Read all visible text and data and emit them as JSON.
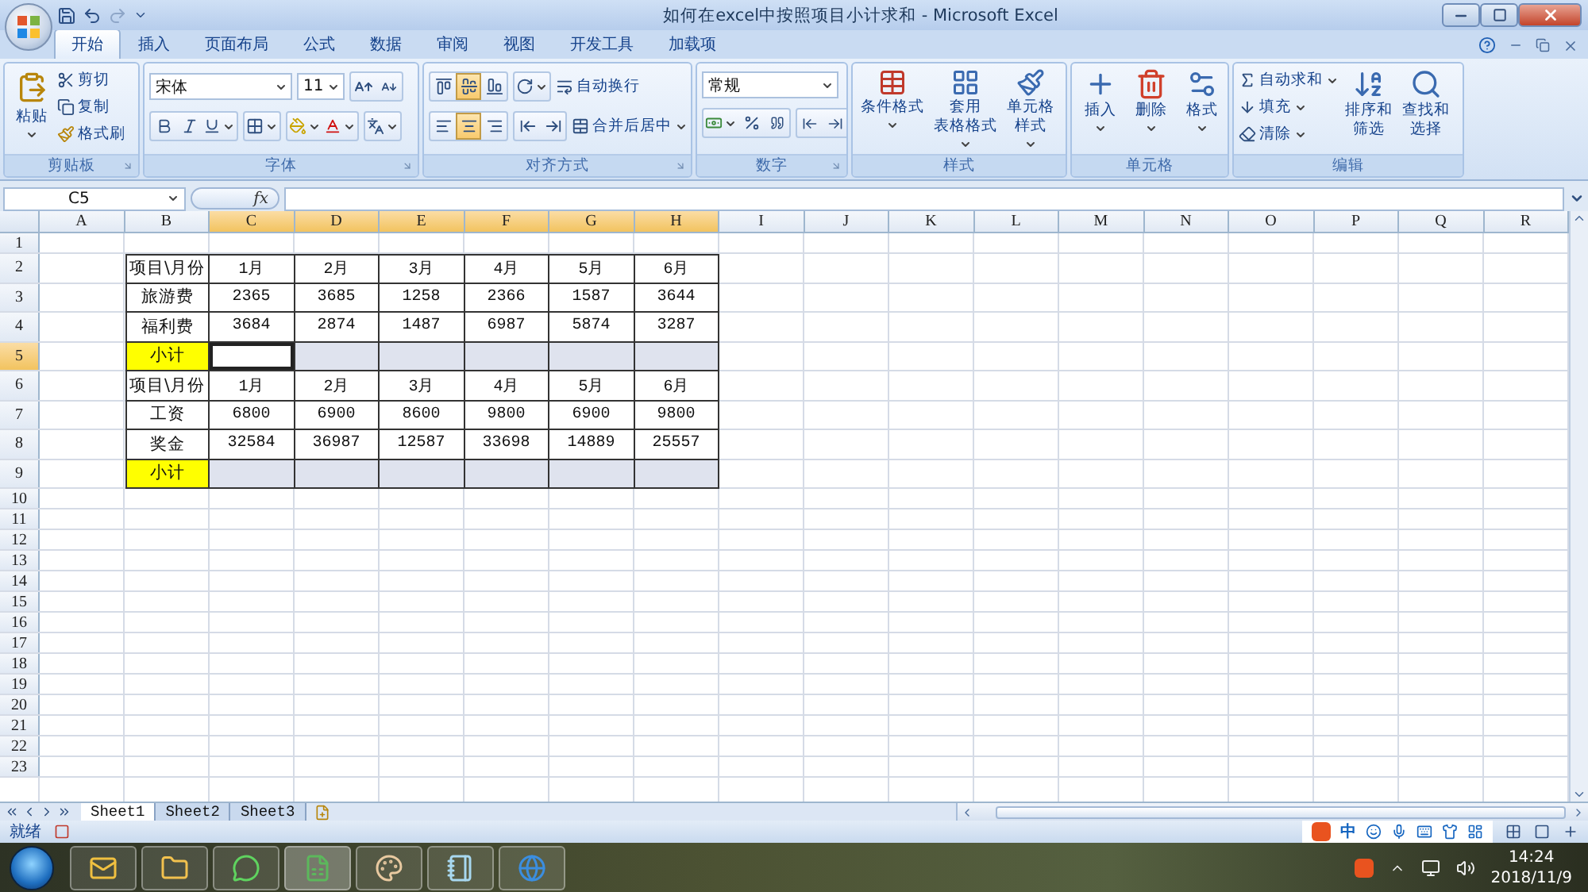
{
  "title_bar": {
    "title": "如何在excel中按照项目小计求和 - Microsoft Excel"
  },
  "tabs": [
    {
      "label": "开始",
      "selected": true
    },
    {
      "label": "插入",
      "selected": false
    },
    {
      "label": "页面布局",
      "selected": false
    },
    {
      "label": "公式",
      "selected": false
    },
    {
      "label": "数据",
      "selected": false
    },
    {
      "label": "审阅",
      "selected": false
    },
    {
      "label": "视图",
      "selected": false
    },
    {
      "label": "开发工具",
      "selected": false
    },
    {
      "label": "加载项",
      "selected": false
    }
  ],
  "ribbon": {
    "clipboard": {
      "label": "剪贴板",
      "paste": "粘贴",
      "cut": "剪切",
      "copy": "复制",
      "format_painter": "格式刷"
    },
    "font": {
      "label": "字体",
      "font_name": "宋体",
      "font_size": "11"
    },
    "alignment": {
      "label": "对齐方式",
      "vertical": [
        {
          "selected": false
        },
        {
          "selected": true
        },
        {
          "selected": false
        }
      ],
      "horizontal": [
        {
          "selected": false
        },
        {
          "selected": true
        },
        {
          "selected": false
        }
      ],
      "wrap_text": "自动换行",
      "merge_center": "合并后居中"
    },
    "number": {
      "label": "数字",
      "format": "常规"
    },
    "styles": {
      "label": "样式",
      "buttons": [
        {
          "lines": [
            "条件格式"
          ]
        },
        {
          "lines": [
            "套用",
            "表格格式"
          ]
        },
        {
          "lines": [
            "单元格",
            "样式"
          ]
        }
      ]
    },
    "cells": {
      "label": "单元格",
      "buttons": [
        "插入",
        "删除",
        "格式"
      ]
    },
    "editing": {
      "label": "编辑",
      "small": [
        "自动求和",
        "填充",
        "清除"
      ],
      "large": [
        {
          "lines": [
            "排序和",
            "筛选"
          ]
        },
        {
          "lines": [
            "查找和",
            "选择"
          ]
        }
      ]
    }
  },
  "formula_bar": {
    "name_box": "C5",
    "function_button": "fx"
  },
  "sheet": {
    "columns": [
      {
        "label": "A",
        "selected": false
      },
      {
        "label": "B",
        "selected": false
      },
      {
        "label": "C",
        "selected": true
      },
      {
        "label": "D",
        "selected": true
      },
      {
        "label": "E",
        "selected": true
      },
      {
        "label": "F",
        "selected": true
      },
      {
        "label": "G",
        "selected": true
      },
      {
        "label": "H",
        "selected": true
      },
      {
        "label": "I",
        "selected": false
      },
      {
        "label": "J",
        "selected": false
      },
      {
        "label": "K",
        "selected": false
      },
      {
        "label": "L",
        "selected": false
      },
      {
        "label": "M",
        "selected": false
      },
      {
        "label": "N",
        "selected": false
      },
      {
        "label": "O",
        "selected": false
      },
      {
        "label": "P",
        "selected": false
      },
      {
        "label": "Q",
        "selected": false
      },
      {
        "label": "R",
        "selected": false
      }
    ],
    "rows": [
      {
        "label": "1",
        "selected": false
      },
      {
        "label": "2",
        "selected": false
      },
      {
        "label": "3",
        "selected": false
      },
      {
        "label": "4",
        "selected": false
      },
      {
        "label": "5",
        "selected": true
      },
      {
        "label": "6",
        "selected": false
      },
      {
        "label": "7",
        "selected": false
      },
      {
        "label": "8",
        "selected": false
      },
      {
        "label": "9",
        "selected": false
      },
      {
        "label": "10",
        "selected": false
      },
      {
        "label": "11",
        "selected": false
      },
      {
        "label": "12",
        "selected": false
      },
      {
        "label": "13",
        "selected": false
      },
      {
        "label": "14",
        "selected": false
      },
      {
        "label": "15",
        "selected": false
      },
      {
        "label": "16",
        "selected": false
      },
      {
        "label": "17",
        "selected": false
      },
      {
        "label": "18",
        "selected": false
      },
      {
        "label": "19",
        "selected": false
      },
      {
        "label": "20",
        "selected": false
      },
      {
        "label": "21",
        "selected": false
      },
      {
        "label": "22",
        "selected": false
      },
      {
        "label": "23",
        "selected": false
      }
    ],
    "table": {
      "rows": [
        {
          "cells": [
            {
              "kind": "label",
              "text": "项目\\月份"
            },
            {
              "kind": "value",
              "text": "1月"
            },
            {
              "kind": "value",
              "text": "2月"
            },
            {
              "kind": "value",
              "text": "3月"
            },
            {
              "kind": "value",
              "text": "4月"
            },
            {
              "kind": "value",
              "text": "5月"
            },
            {
              "kind": "value",
              "text": "6月"
            }
          ]
        },
        {
          "cells": [
            {
              "kind": "label",
              "text": "旅游费"
            },
            {
              "kind": "value",
              "text": "2365"
            },
            {
              "kind": "value",
              "text": "3685"
            },
            {
              "kind": "value",
              "text": "1258"
            },
            {
              "kind": "value",
              "text": "2366"
            },
            {
              "kind": "value",
              "text": "1587"
            },
            {
              "kind": "value",
              "text": "3644"
            }
          ]
        },
        {
          "cells": [
            {
              "kind": "label",
              "text": "福利费"
            },
            {
              "kind": "value",
              "text": "3684"
            },
            {
              "kind": "value",
              "text": "2874"
            },
            {
              "kind": "value",
              "text": "1487"
            },
            {
              "kind": "value",
              "text": "6987"
            },
            {
              "kind": "value",
              "text": "5874"
            },
            {
              "kind": "value",
              "text": "3287"
            }
          ]
        },
        {
          "cells": [
            {
              "kind": "total-label",
              "text": "小计"
            },
            {
              "kind": "total",
              "selected": true
            },
            {
              "kind": "total",
              "selected": false
            },
            {
              "kind": "total",
              "selected": false
            },
            {
              "kind": "total",
              "selected": false
            },
            {
              "kind": "total",
              "selected": false
            },
            {
              "kind": "total",
              "selected": false
            }
          ]
        },
        {
          "cells": [
            {
              "kind": "label",
              "text": "项目\\月份"
            },
            {
              "kind": "value",
              "text": "1月"
            },
            {
              "kind": "value",
              "text": "2月"
            },
            {
              "kind": "value",
              "text": "3月"
            },
            {
              "kind": "value",
              "text": "4月"
            },
            {
              "kind": "value",
              "text": "5月"
            },
            {
              "kind": "value",
              "text": "6月"
            }
          ]
        },
        {
          "cells": [
            {
              "kind": "label",
              "text": "工资"
            },
            {
              "kind": "value",
              "text": "6800"
            },
            {
              "kind": "value",
              "text": "6900"
            },
            {
              "kind": "value",
              "text": "8600"
            },
            {
              "kind": "value",
              "text": "9800"
            },
            {
              "kind": "value",
              "text": "6900"
            },
            {
              "kind": "value",
              "text": "9800"
            }
          ]
        },
        {
          "cells": [
            {
              "kind": "label",
              "text": "奖金"
            },
            {
              "kind": "value",
              "text": "32584"
            },
            {
              "kind": "value",
              "text": "36987"
            },
            {
              "kind": "value",
              "text": "12587"
            },
            {
              "kind": "value",
              "text": "33698"
            },
            {
              "kind": "value",
              "text": "14889"
            },
            {
              "kind": "value",
              "text": "25557"
            }
          ]
        },
        {
          "cells": [
            {
              "kind": "total-label",
              "text": "小计"
            },
            {
              "kind": "total",
              "selected": false
            },
            {
              "kind": "total",
              "selected": false
            },
            {
              "kind": "total",
              "selected": false
            },
            {
              "kind": "total",
              "selected": false
            },
            {
              "kind": "total",
              "selected": false
            },
            {
              "kind": "total",
              "selected": false
            }
          ]
        }
      ]
    }
  },
  "sheet_tabs": [
    {
      "label": "Sheet1",
      "selected": true
    },
    {
      "label": "Sheet2",
      "selected": false
    },
    {
      "label": "Sheet3",
      "selected": false
    }
  ],
  "status_bar": {
    "status": "就绪",
    "ime": "中"
  },
  "taskbar": {
    "time": "14:24",
    "date": "2018/11/9"
  }
}
